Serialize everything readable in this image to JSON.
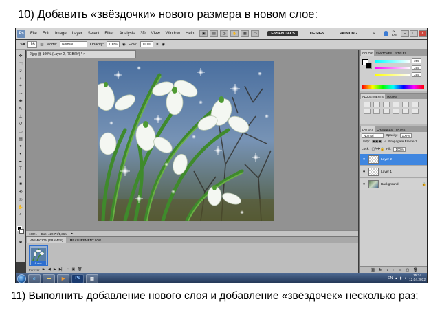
{
  "heading": "10) Добавить «звёздочки» нового размера в новом слое:",
  "caption": "11) Выполнить добавление нового слоя и добавление «звёздочек» несколько раз;",
  "app": {
    "logo": "Ps",
    "menu": [
      "File",
      "Edit",
      "Image",
      "Layer",
      "Select",
      "Filter",
      "Analysis",
      "3D",
      "View",
      "Window",
      "Help"
    ],
    "workspaces": [
      "ESSENTIALS",
      "DESIGN",
      "PAINTING"
    ],
    "cs_live": "CS Live"
  },
  "options": {
    "brush_size": "16",
    "mode_label": "Mode:",
    "mode_value": "Normal",
    "opacity_label": "Opacity:",
    "opacity_value": "100%",
    "flow_label": "Flow:",
    "flow_value": "100%"
  },
  "document": {
    "tab_title": "2.jpg @ 100% (Layer 2, RGB/8#) *",
    "zoom": "100%",
    "doc_size": "Doc: 422.7K/1,36M"
  },
  "animation": {
    "tabs": [
      "ANIMATION (FRAMES)",
      "MEASUREMENT LOG"
    ],
    "frame_delay": "0 sec.",
    "loop": "Forever"
  },
  "color_panel": {
    "tabs": [
      "COLOR",
      "SWATCHES",
      "STYLES"
    ],
    "r": "255",
    "g": "255",
    "b": "255"
  },
  "adjustments": {
    "tabs": [
      "ADJUSTMENTS",
      "MASKS"
    ]
  },
  "layers_panel": {
    "tabs": [
      "LAYERS",
      "CHANNELS",
      "PATHS"
    ],
    "blend_mode": "Normal",
    "opacity_label": "Opacity:",
    "opacity_value": "100%",
    "unify_label": "Unify:",
    "propagate_label": "Propagate Frame 1",
    "lock_label": "Lock:",
    "fill_label": "Fill:",
    "fill_value": "100%",
    "layers": [
      {
        "name": "Layer 2",
        "selected": true
      },
      {
        "name": "Layer 1",
        "selected": false
      },
      {
        "name": "Background",
        "selected": false
      }
    ]
  },
  "taskbar": {
    "lang": "EN",
    "time": "15:34",
    "date": "12.04.2012"
  },
  "colors": {
    "selection": "#3f86e0",
    "taskbar": "#1e3251"
  }
}
